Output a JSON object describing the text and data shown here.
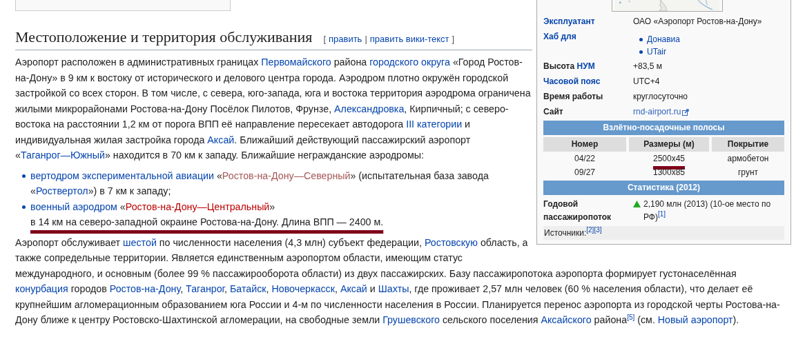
{
  "section": {
    "heading": "Местоположение и территория обслуживания",
    "edit": {
      "open": "[",
      "separator": "|",
      "close": "]",
      "links": [
        "править",
        "править вики-текст"
      ]
    }
  },
  "body": [
    {
      "kind": "paragraph",
      "segments": [
        {
          "kind": "text",
          "text": "Аэропорт расположен в административных границах "
        },
        {
          "kind": "link",
          "text": "Первомайского"
        },
        {
          "kind": "text",
          "text": " района "
        },
        {
          "kind": "link",
          "text": "городского округа"
        },
        {
          "kind": "text",
          "text": " «Город Ростов-на-Дону» в 9 км к востоку от исторического и делового центра города. Аэродром плотно окружён городской застройкой со всех сторон. В том числе, с севера, юго-запада, юга и востока территория аэродрома ограничена жилыми микрорайонами Ростова-на-Дону Посёлок Пилотов, Фрунзе, "
        },
        {
          "kind": "link",
          "text": "Александровка"
        },
        {
          "kind": "text",
          "text": ", Кирпичный; с северо-востока на расстоянии 1,2 км от порога ВПП её направление пересекает автодорога "
        },
        {
          "kind": "link",
          "text": "III категории"
        },
        {
          "kind": "text",
          "text": " и индивидуальная жилая застройка города "
        },
        {
          "kind": "link",
          "text": "Аксай"
        },
        {
          "kind": "text",
          "text": ". Ближайший действующий пассажирский аэропорт «"
        },
        {
          "kind": "link",
          "text": "Таганрог—Южный"
        },
        {
          "kind": "text",
          "text": "» находится в 70 км к западу. Ближайшие негражданские аэродромы:"
        }
      ]
    },
    {
      "kind": "list",
      "items": [
        {
          "segments": [
            {
              "kind": "link",
              "text": "вертодром экспериментальной авиации"
            },
            {
              "kind": "text",
              "text": " «"
            },
            {
              "kind": "visited-redlink",
              "text": "Ростов-на-Дону—Северный"
            },
            {
              "kind": "text",
              "text": "» (испытательная база завода «"
            },
            {
              "kind": "link",
              "text": "Роствертол"
            },
            {
              "kind": "text",
              "text": "») в 7 км к западу;"
            }
          ]
        },
        {
          "segments": [
            {
              "kind": "link",
              "text": "военный аэродром"
            },
            {
              "kind": "text",
              "text": " «"
            },
            {
              "kind": "redlink",
              "text": "Ростов-на-Дону—Центральный"
            },
            {
              "kind": "text",
              "text": "» "
            },
            {
              "kind": "text",
              "text": "в 14 км на северо-западной окраине Ростова-на-Дону. ",
              "marked": true
            },
            {
              "kind": "text",
              "text": "Длина ВПП — 2400 м.",
              "marked": true
            }
          ]
        }
      ]
    },
    {
      "kind": "paragraph",
      "segments": [
        {
          "kind": "text",
          "text": "Аэропорт обслуживает "
        },
        {
          "kind": "link",
          "text": "шестой"
        },
        {
          "kind": "text",
          "text": " по численности населения (4,3 млн) субъект федерации, "
        },
        {
          "kind": "link",
          "text": "Ростовскую"
        },
        {
          "kind": "text",
          "text": " область, а также сопредельные территории. Является единственным аэропортом области, имеющим статус международного, и основным (более 99 % пассажирооборота области) из двух пассажирских. Базу пассажиропотока аэропорта формирует густонаселённая "
        },
        {
          "kind": "link",
          "text": "конурбация"
        },
        {
          "kind": "text",
          "text": " городов "
        },
        {
          "kind": "link",
          "text": "Ростов-на-Дону"
        },
        {
          "kind": "text",
          "text": ", "
        },
        {
          "kind": "link",
          "text": "Таганрог"
        },
        {
          "kind": "text",
          "text": ", "
        },
        {
          "kind": "link",
          "text": "Батайск"
        },
        {
          "kind": "text",
          "text": ", "
        },
        {
          "kind": "link",
          "text": "Новочеркасск"
        },
        {
          "kind": "text",
          "text": ", "
        },
        {
          "kind": "link",
          "text": "Аксай"
        },
        {
          "kind": "text",
          "text": " и "
        },
        {
          "kind": "link",
          "text": "Шахты"
        },
        {
          "kind": "text",
          "text": ", где проживает 2,57 млн человек (60 % населения области), что делает её крупнейшим агломерационным образованием юга России и 4-м по численности населения в России. Планируется перенос аэропорта из городской черты Ростова-на-Дону ближе к центру Ростовско-Шахтинской агломерации, на свободные земли "
        },
        {
          "kind": "link",
          "text": "Грушевского"
        },
        {
          "kind": "text",
          "text": " сельского поселения "
        },
        {
          "kind": "link",
          "text": "Аксайского"
        },
        {
          "kind": "text",
          "text": " района"
        },
        {
          "kind": "ref",
          "text": "[5]"
        },
        {
          "kind": "text",
          "text": " (см. "
        },
        {
          "kind": "link",
          "text": "Новый аэропорт"
        },
        {
          "kind": "text",
          "text": ")."
        }
      ]
    }
  ],
  "infobox": {
    "rows": [
      {
        "label": [
          {
            "kind": "link",
            "text": "Эксплуатант"
          }
        ],
        "value": [
          {
            "kind": "text",
            "text": "ОАО «Аэропорт Ростов-на-Дону»"
          }
        ]
      },
      {
        "label": [
          {
            "kind": "link",
            "text": "Хаб для"
          }
        ],
        "list": [
          [
            {
              "kind": "link",
              "text": "Донавиа"
            }
          ],
          [
            {
              "kind": "link",
              "text": "UTair"
            }
          ]
        ]
      },
      {
        "label": [
          {
            "kind": "text",
            "text": "Высота "
          },
          {
            "kind": "link",
            "text": "НУМ"
          }
        ],
        "value": [
          {
            "kind": "text",
            "text": "+83,5 м"
          }
        ]
      },
      {
        "label": [
          {
            "kind": "link",
            "text": "Часовой пояс"
          }
        ],
        "value": [
          {
            "kind": "text",
            "text": "UTC+4"
          }
        ]
      },
      {
        "label": [
          {
            "kind": "text",
            "text": "Время работы"
          }
        ],
        "value": [
          {
            "kind": "text",
            "text": "круглосуточно"
          }
        ]
      },
      {
        "label": [
          {
            "kind": "text",
            "text": "Сайт"
          }
        ],
        "value": [
          {
            "kind": "external",
            "text": "rnd-airport.ru"
          }
        ]
      }
    ],
    "runways": {
      "title": "Взлётно-посадочные полосы",
      "columns": [
        "Номер",
        "Размеры (м)",
        "Покрытие"
      ],
      "rows": [
        [
          {
            "text": "04/22"
          },
          {
            "text": "2500x45",
            "marked": true
          },
          {
            "text": "армобетон"
          }
        ],
        [
          {
            "text": "09/27"
          },
          {
            "text": "1300x85"
          },
          {
            "text": "грунт"
          }
        ]
      ]
    },
    "stats": {
      "title": "Статистика (2012)",
      "rows": [
        {
          "label": "Годовой пассажиропоток",
          "increase": true,
          "value": [
            {
              "kind": "text",
              "text": "2,190 млн (2013) (10-ое место по РФ)"
            },
            {
              "kind": "ref",
              "text": "[1]"
            }
          ]
        }
      ]
    },
    "sources": [
      {
        "kind": "text",
        "text": "Источники:"
      },
      {
        "kind": "ref",
        "text": "[2]"
      },
      {
        "kind": "ref",
        "text": "[3]"
      }
    ]
  }
}
